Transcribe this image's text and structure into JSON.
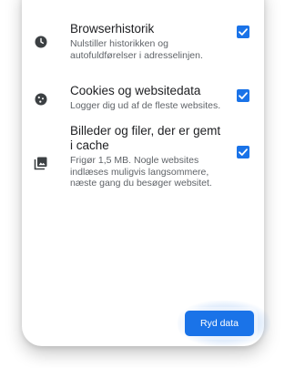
{
  "options": [
    {
      "icon": "clock-icon",
      "title": "Browserhistorik",
      "description": "Nulstiller historikken og autofuldførelser i adresselinjen.",
      "checked": true
    },
    {
      "icon": "cookie-icon",
      "title": "Cookies og websitedata",
      "description": "Logger dig ud af de fleste websites.",
      "checked": true
    },
    {
      "icon": "image-icon",
      "title": "Billeder og filer, der er gemt i cache",
      "description": "Frigør 1,5 MB. Nogle websites indlæses muligvis langsommere, næste gang du besøger websitet.",
      "checked": true
    }
  ],
  "actions": {
    "clear_label": "Ryd data"
  },
  "colors": {
    "accent": "#1a73e8",
    "title_text": "#202124",
    "secondary_text": "#5f6368",
    "icon": "#3c4043"
  }
}
